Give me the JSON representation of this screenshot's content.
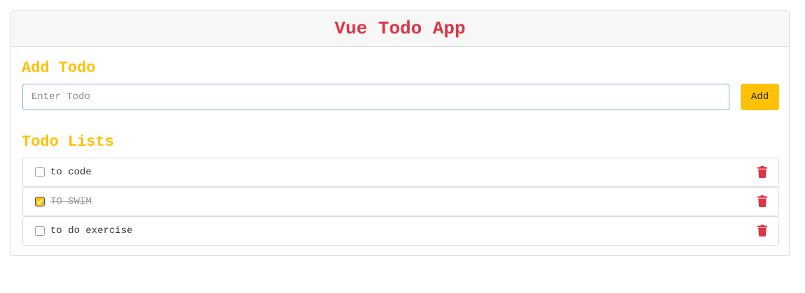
{
  "header": {
    "title": "Vue Todo App"
  },
  "add_section": {
    "title": "Add Todo",
    "input_placeholder": "Enter Todo",
    "input_value": "",
    "add_label": "Add"
  },
  "list_section": {
    "title": "Todo Lists",
    "items": [
      {
        "text": "to code",
        "done": false
      },
      {
        "text": "TO SWIM",
        "done": true
      },
      {
        "text": "to do exercise",
        "done": false
      }
    ]
  },
  "colors": {
    "title_red": "#dc3545",
    "accent_yellow": "#ffc107",
    "trash_red": "#dc3545"
  },
  "icons": {
    "delete": "trash-icon",
    "check": "check-icon"
  }
}
